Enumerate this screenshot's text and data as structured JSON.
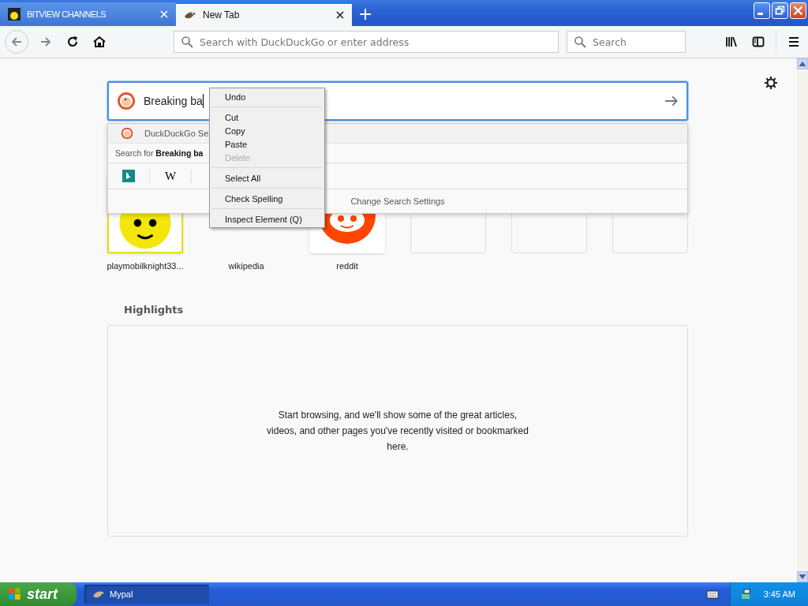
{
  "tabs": [
    {
      "title": "BITVIEW CHANNELS",
      "selected": false,
      "kind": "avatar"
    },
    {
      "title": "New Tab",
      "selected": true,
      "kind": "mypal"
    }
  ],
  "toolbar": {
    "address_placeholder": "Search with DuckDuckGo or enter address",
    "search_placeholder": "Search"
  },
  "new_tab": {
    "search_value": "Breaking ba",
    "dropdown": {
      "engine_row": "DuckDuckGo Se",
      "search_for": "Search for **Breaking ba**",
      "one_offs": [
        {
          "kind": "bing"
        },
        {
          "kind": "wikipedia",
          "label": "W"
        }
      ],
      "settings": "Change Search Settings"
    },
    "top_sites": [
      {
        "kind": "avatar",
        "label": "playmobilknight33..."
      },
      {
        "kind": "covered",
        "label": "wikipedia"
      },
      {
        "kind": "reddit",
        "label": "reddit"
      },
      {
        "kind": "empty"
      },
      {
        "kind": "empty"
      },
      {
        "kind": "empty"
      }
    ],
    "highlights": {
      "title": "Highlights",
      "message": "Start browsing, and we'll show some of the great articles, videos, and other pages you've recently visited or bookmarked here."
    }
  },
  "context_menu": {
    "groups": [
      [
        {
          "label": "Undo",
          "disabled": false
        }
      ],
      [
        {
          "label": "Cut",
          "disabled": false
        },
        {
          "label": "Copy",
          "disabled": false
        },
        {
          "label": "Paste",
          "disabled": false
        },
        {
          "label": "Delete",
          "disabled": true
        }
      ],
      [
        {
          "label": "Select All",
          "disabled": false
        }
      ],
      [
        {
          "label": "Check Spelling",
          "disabled": false
        }
      ],
      [
        {
          "label": "Inspect Element (Q)",
          "disabled": false
        }
      ]
    ]
  },
  "taskbar": {
    "start": "start",
    "tasks": [
      {
        "label": "Mypal",
        "selected": true
      }
    ],
    "clock": "3:45 AM"
  }
}
